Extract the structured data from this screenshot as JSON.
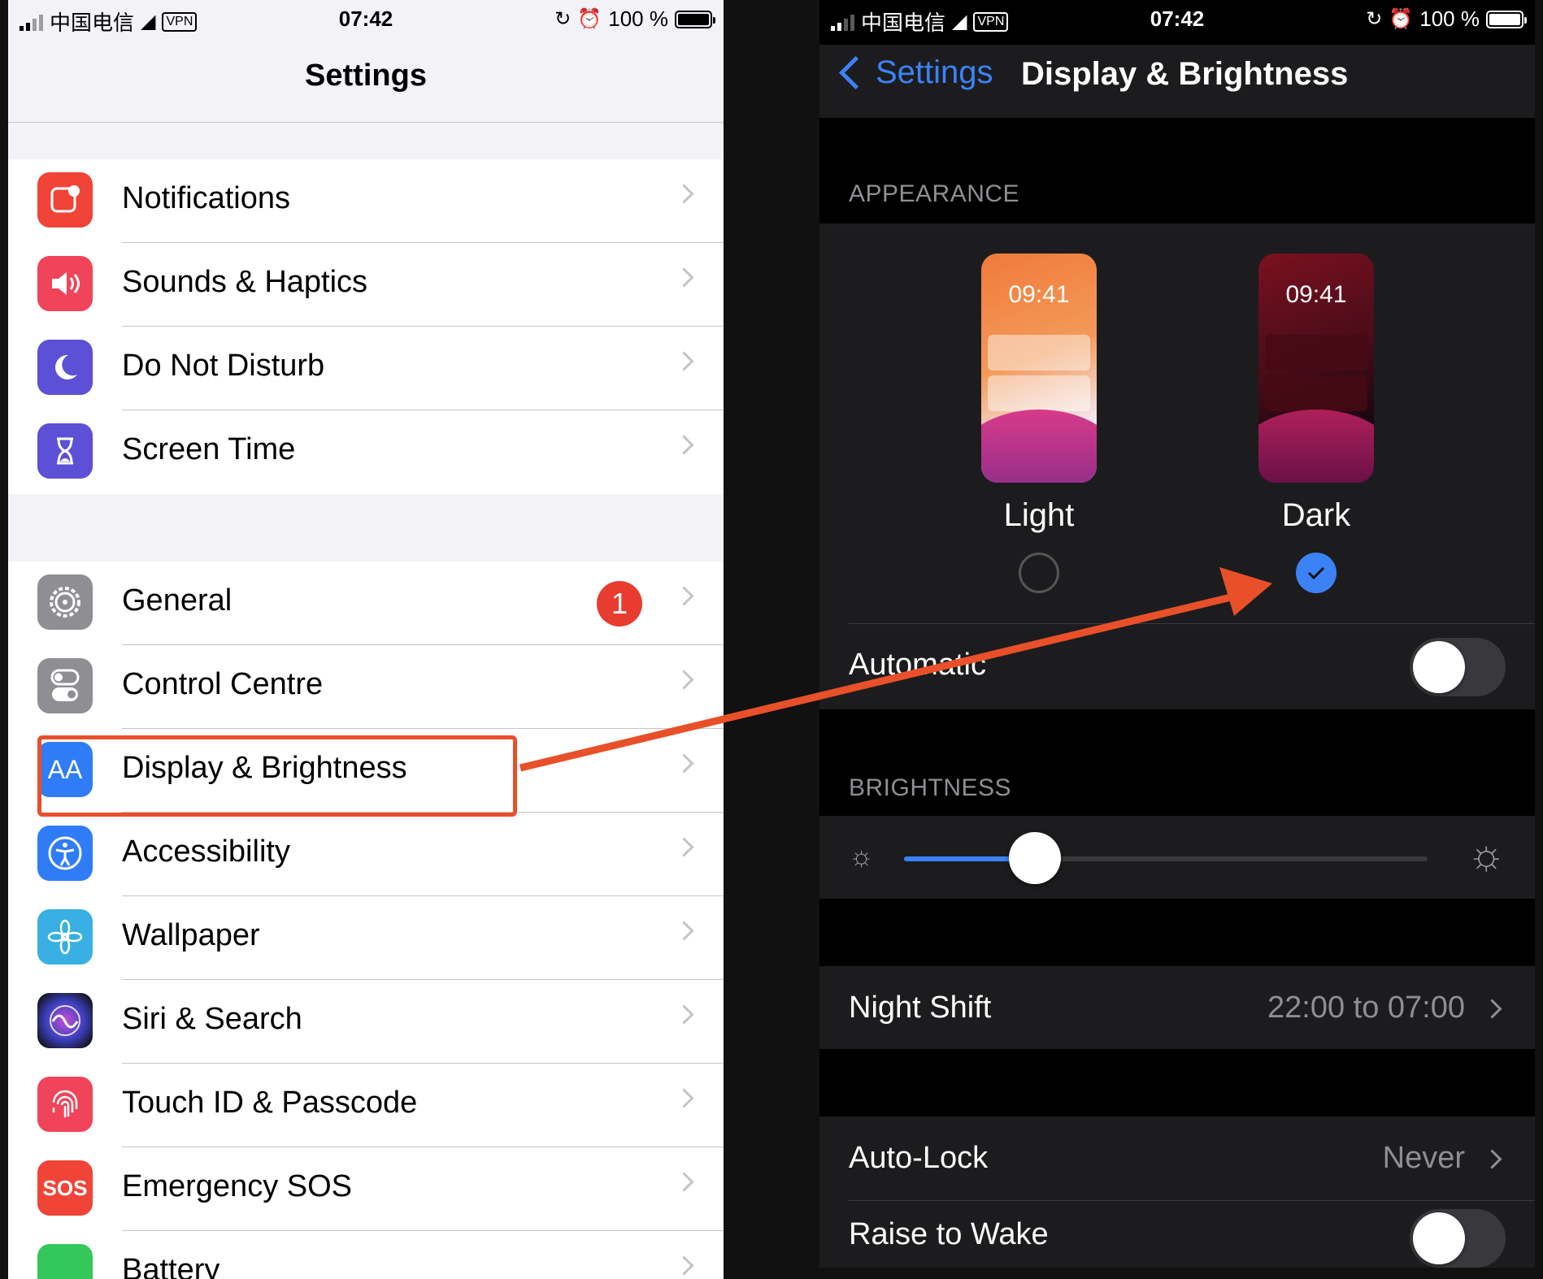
{
  "status_bar": {
    "carrier": "中国电信",
    "vpn": "VPN",
    "time": "07:42",
    "battery": "100 %"
  },
  "left": {
    "title": "Settings",
    "group1": [
      {
        "label": "Notifications",
        "icon": "notifications-icon",
        "color": "#f04438"
      },
      {
        "label": "Sounds & Haptics",
        "icon": "speaker-icon",
        "color": "#f0445a"
      },
      {
        "label": "Do Not Disturb",
        "icon": "moon-icon",
        "color": "#5b50d6"
      },
      {
        "label": "Screen Time",
        "icon": "hourglass-icon",
        "color": "#5b50d6"
      }
    ],
    "group2": [
      {
        "label": "General",
        "icon": "gear-icon",
        "color": "#8e8e93",
        "badge": "1"
      },
      {
        "label": "Control Centre",
        "icon": "switches-icon",
        "color": "#8e8e93"
      },
      {
        "label": "Display & Brightness",
        "icon": "aa-icon",
        "color": "#2f7cf6",
        "icon_text": "AA"
      },
      {
        "label": "Accessibility",
        "icon": "accessibility-icon",
        "color": "#2f7cf6"
      },
      {
        "label": "Wallpaper",
        "icon": "flower-icon",
        "color": "#38b0e3"
      },
      {
        "label": "Siri & Search",
        "icon": "siri-icon",
        "color": "#1a1a3a"
      },
      {
        "label": "Touch ID & Passcode",
        "icon": "fingerprint-icon",
        "color": "#f0445a"
      },
      {
        "label": "Emergency SOS",
        "icon": "sos-icon",
        "color": "#f04438",
        "icon_text": "SOS"
      },
      {
        "label": "Battery",
        "icon": "battery-icon",
        "color": "#34c759"
      }
    ]
  },
  "right": {
    "back_label": "Settings",
    "title": "Display & Brightness",
    "appearance_header": "APPEARANCE",
    "light": {
      "label": "Light",
      "time": "09:41",
      "selected": false
    },
    "dark": {
      "label": "Dark",
      "time": "09:41",
      "selected": true
    },
    "automatic_label": "Automatic",
    "automatic_on": false,
    "brightness_header": "BRIGHTNESS",
    "brightness_level": 0.25,
    "night_shift": {
      "label": "Night Shift",
      "value": "22:00 to 07:00"
    },
    "auto_lock": {
      "label": "Auto-Lock",
      "value": "Never"
    },
    "raise_to_wake": {
      "label": "Raise to Wake",
      "on": false
    }
  },
  "colors": {
    "accent": "#3b82f6",
    "annotation": "#e8502a",
    "badge": "#e73c2f"
  }
}
